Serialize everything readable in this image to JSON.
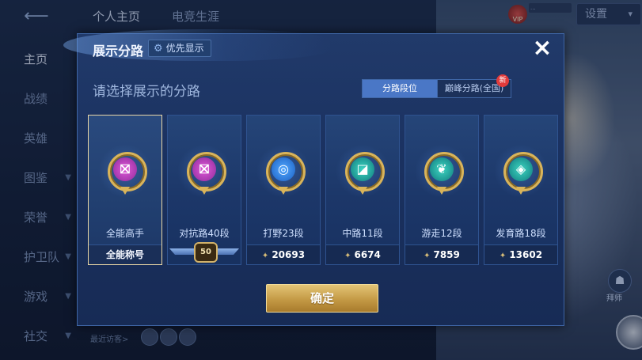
{
  "topbar": {
    "tabs": [
      "个人主页",
      "电竞生涯"
    ],
    "settings_label": "设置",
    "vip_label": "VIP",
    "coin_placeholder": "..."
  },
  "sidebar": {
    "items": [
      {
        "label": "主页",
        "active": true
      },
      {
        "label": "战绩",
        "active": false
      },
      {
        "label": "英雄",
        "active": false
      },
      {
        "label": "图鉴",
        "active": false,
        "chevron": true
      },
      {
        "label": "荣誉",
        "active": false,
        "chevron": true
      },
      {
        "label": "护卫队",
        "active": false,
        "chevron": true
      },
      {
        "label": "游戏",
        "active": false,
        "chevron": true
      },
      {
        "label": "社交",
        "active": false,
        "chevron": true
      }
    ]
  },
  "recent": {
    "label": "最近访客>"
  },
  "right_widget": {
    "label": "拜师"
  },
  "dialog": {
    "title": "展示分路",
    "priority_label": "优先显示",
    "close_icon": "×",
    "prompt": "请选择展示的分路",
    "tabs": [
      {
        "label": "分路段位",
        "active": true
      },
      {
        "label": "巅峰分路(全国)",
        "active": false
      }
    ],
    "new_badge": "新",
    "cards": [
      {
        "title": "全能高手",
        "footer": "全能称号",
        "emblem": "pink",
        "glyph": "⛝",
        "selected": true
      },
      {
        "title": "对抗路40段",
        "footer": "",
        "emblem": "pink",
        "glyph": "⛝",
        "star_level": "50",
        "selected": false
      },
      {
        "title": "打野23段",
        "footer": "20693",
        "emblem": "blue",
        "glyph": "◎",
        "selected": false
      },
      {
        "title": "中路11段",
        "footer": "6674",
        "emblem": "teal",
        "glyph": "◪",
        "selected": false
      },
      {
        "title": "游走12段",
        "footer": "7859",
        "emblem": "teal",
        "glyph": "❦",
        "selected": false
      },
      {
        "title": "发育路18段",
        "footer": "13602",
        "emblem": "teal",
        "glyph": "◈",
        "selected": false
      }
    ],
    "confirm_label": "确定"
  },
  "colors": {
    "dialog_bg": "#1a3160",
    "tab_active": "#4a77c6",
    "gold": "#d9b45a",
    "selected_border": "#e9d7a6"
  }
}
